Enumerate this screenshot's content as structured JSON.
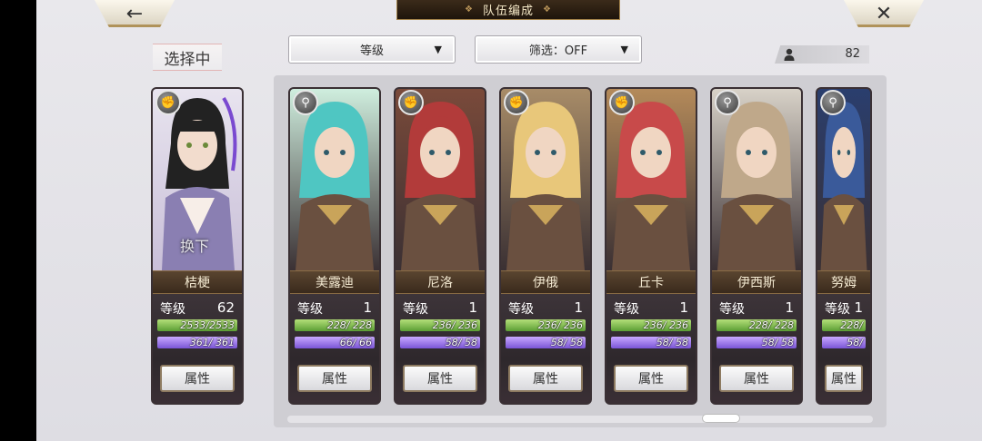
{
  "header": {
    "title": "队伍编成",
    "back_label": "←",
    "close_label": "✕"
  },
  "selecting_label": "选择中",
  "sort": {
    "value": "等级",
    "arrow": "▼"
  },
  "filter": {
    "value": "筛选：OFF",
    "arrow": "▼"
  },
  "unit_count": "82",
  "level_label": "等级",
  "attr_label": "属性",
  "selected_card": {
    "name": "桔梗",
    "level": "62",
    "hp": "2533/2533",
    "mp": "361/ 361",
    "type_icon": "gauntlet-icon",
    "overlay_text": "换下"
  },
  "cards": [
    {
      "name": "美露迪",
      "level": "1",
      "hp": "228/ 228",
      "mp": "66/ 66",
      "type_icon": "staff-icon",
      "hair": "#4fc6c2",
      "bg": "#cfeede"
    },
    {
      "name": "尼洛",
      "level": "1",
      "hp": "236/ 236",
      "mp": "58/ 58",
      "type_icon": "gauntlet-icon",
      "hair": "#b23b3a",
      "bg": "#7a4a3a"
    },
    {
      "name": "伊俄",
      "level": "1",
      "hp": "236/ 236",
      "mp": "58/ 58",
      "type_icon": "gauntlet-icon",
      "hair": "#e8c77a",
      "bg": "#a88c68"
    },
    {
      "name": "丘卡",
      "level": "1",
      "hp": "236/ 236",
      "mp": "58/ 58",
      "type_icon": "gauntlet-icon",
      "hair": "#c84a4a",
      "bg": "#b48a5a"
    },
    {
      "name": "伊西斯",
      "level": "1",
      "hp": "228/ 228",
      "mp": "58/ 58",
      "type_icon": "staff-icon",
      "hair": "#bfa88a",
      "bg": "#d8d2c8"
    },
    {
      "name": "努姆",
      "level": "1",
      "hp": "228/",
      "mp": "58/",
      "type_icon": "staff-icon",
      "hair": "#3a5a9a",
      "bg": "#2a3e6e"
    }
  ]
}
